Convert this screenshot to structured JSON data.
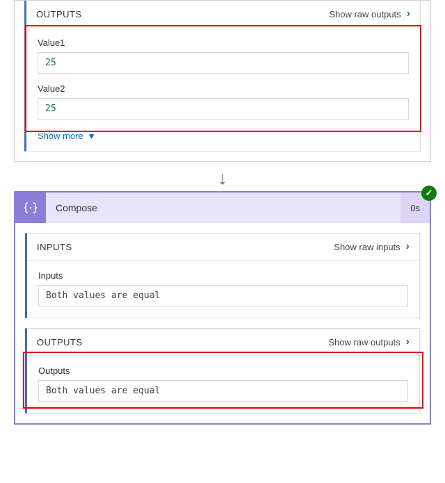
{
  "top": {
    "outputs_header": "OUTPUTS",
    "show_raw_outputs": "Show raw outputs",
    "fields": {
      "value1_label": "Value1",
      "value1_value": "25",
      "value2_label": "Value2",
      "value2_value": "25"
    },
    "show_more": "Show more"
  },
  "compose": {
    "title": "Compose",
    "duration": "0s",
    "inputs_header": "INPUTS",
    "show_raw_inputs": "Show raw inputs",
    "inputs_label": "Inputs",
    "inputs_value": "Both values are equal",
    "outputs_header": "OUTPUTS",
    "show_raw_outputs": "Show raw outputs",
    "outputs_label": "Outputs",
    "outputs_value": "Both values are equal"
  }
}
